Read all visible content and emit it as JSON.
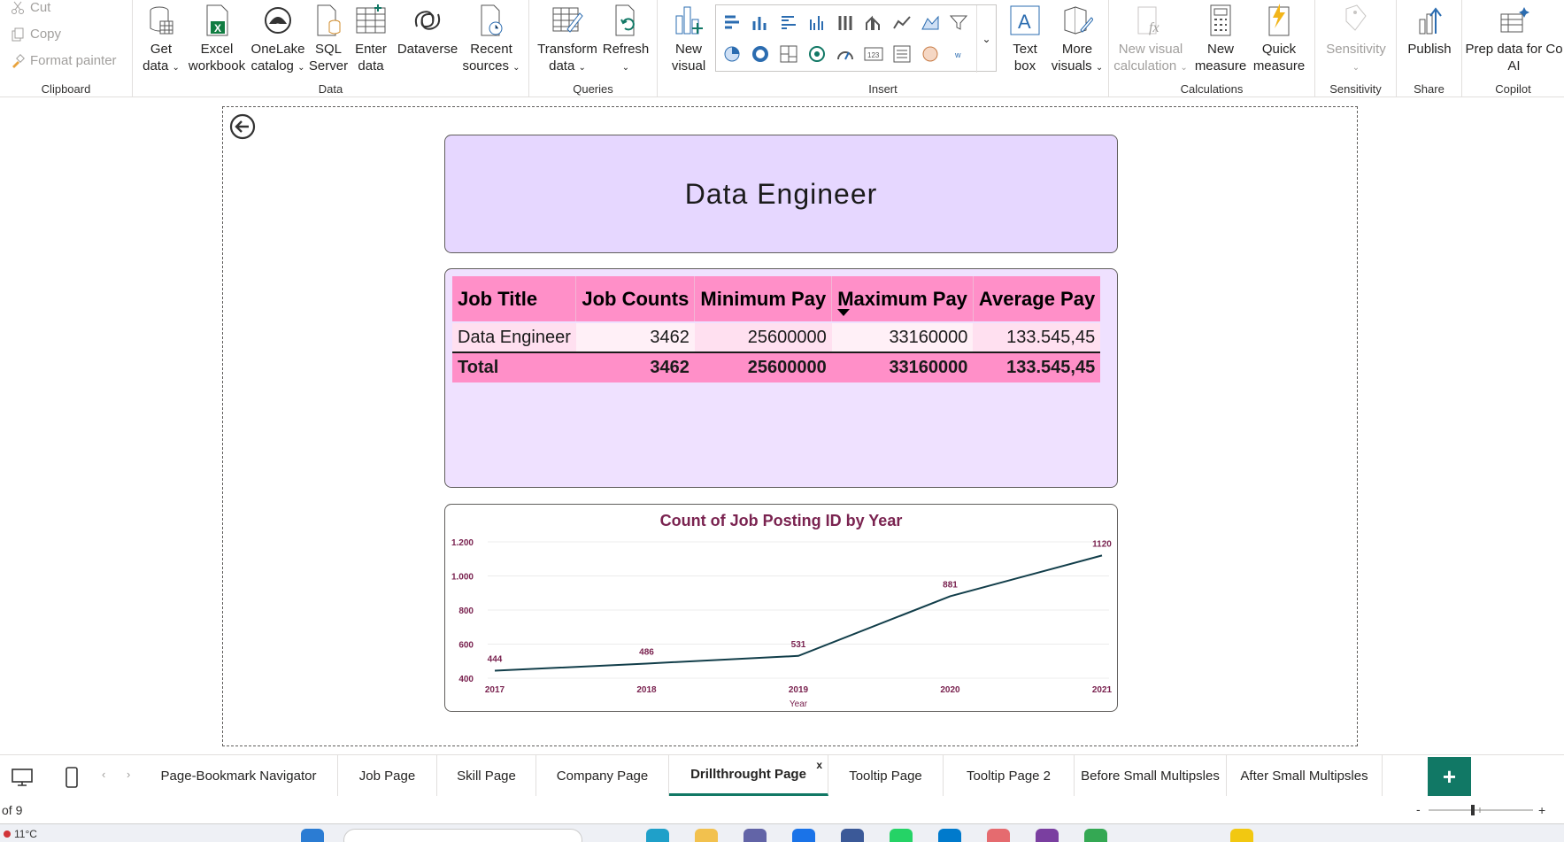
{
  "ribbon": {
    "clipboard": {
      "cut": "Cut",
      "copy": "Copy",
      "format_painter": "Format painter",
      "label": "Clipboard"
    },
    "data": {
      "label": "Data",
      "buttons": [
        {
          "l1": "Get",
          "l2": "data",
          "chev": true
        },
        {
          "l1": "Excel",
          "l2": "workbook",
          "chev": false
        },
        {
          "l1": "OneLake",
          "l2": "catalog",
          "chev": true
        },
        {
          "l1": "SQL",
          "l2": "Server",
          "chev": false
        },
        {
          "l1": "Enter",
          "l2": "data",
          "chev": false
        },
        {
          "l1": "Dataverse",
          "l2": "",
          "chev": false
        },
        {
          "l1": "Recent",
          "l2": "sources",
          "chev": true
        }
      ]
    },
    "queries": {
      "label": "Queries",
      "buttons": [
        {
          "l1": "Transform",
          "l2": "data",
          "chev": true
        },
        {
          "l1": "Refresh",
          "l2": "",
          "chev": true
        }
      ]
    },
    "insert": {
      "label": "Insert",
      "new_visual": {
        "l1": "New",
        "l2": "visual"
      },
      "text_box": {
        "l1": "Text",
        "l2": "box"
      },
      "more_visuals": {
        "l1": "More",
        "l2": "visuals"
      }
    },
    "calculations": {
      "label": "Calculations",
      "new_visual_calc": {
        "l1": "New visual",
        "l2": "calculation"
      },
      "new_measure": {
        "l1": "New",
        "l2": "measure"
      },
      "quick_measure": {
        "l1": "Quick",
        "l2": "measure"
      }
    },
    "sensitivity": {
      "label": "Sensitivity",
      "button": "Sensitivity"
    },
    "share": {
      "label": "Share",
      "button": "Publish"
    },
    "copilot": {
      "label": "Copilot",
      "l1": "Prep data for Co",
      "l2": "AI"
    }
  },
  "canvas": {
    "title": "Data Engineer",
    "table": {
      "headers": [
        "Job Title",
        "Job Counts",
        "Minimum Pay",
        "Maximum Pay",
        "Average Pay"
      ],
      "rows": [
        [
          "Data Engineer",
          "3462",
          "25600000",
          "33160000",
          "133.545,45"
        ]
      ],
      "total": [
        "Total",
        "3462",
        "25600000",
        "33160000",
        "133.545,45"
      ],
      "sorted_column": "Maximum Pay"
    }
  },
  "chart_data": {
    "type": "line",
    "title": "Count of Job Posting ID by Year",
    "xlabel": "Year",
    "ylabel": "",
    "x": [
      "2017",
      "2018",
      "2019",
      "2020",
      "2021"
    ],
    "series": [
      {
        "values": [
          444,
          486,
          531,
          881,
          1120
        ]
      }
    ],
    "ylim": [
      400,
      1200
    ],
    "yticks": [
      400,
      600,
      800,
      1000,
      1200
    ],
    "ytick_labels": [
      "400",
      "600",
      "800",
      "1.000",
      "1.200"
    ],
    "grid": true,
    "data_labels": true,
    "colors": {
      "line": "#123e4a",
      "labels": "#7a2350"
    }
  },
  "tabs": {
    "items": [
      "Page-Bookmark Navigator",
      "Job Page",
      "Skill Page",
      "Company Page",
      "Drillthrought Page",
      "Tooltip Page",
      "Tooltip Page 2",
      "Before Small Multipsles",
      "After Small Multipsles"
    ],
    "active": "Drillthrought Page",
    "close_glyph": "x",
    "add_glyph": "+"
  },
  "status": {
    "page_count": "of 9"
  },
  "taskbar": {
    "temperature": "11°C"
  },
  "colors": {
    "accent": "#117865",
    "title_card": "#e6d7ff",
    "table_header": "#ff8fc8",
    "table_card": "#efe1ff"
  }
}
